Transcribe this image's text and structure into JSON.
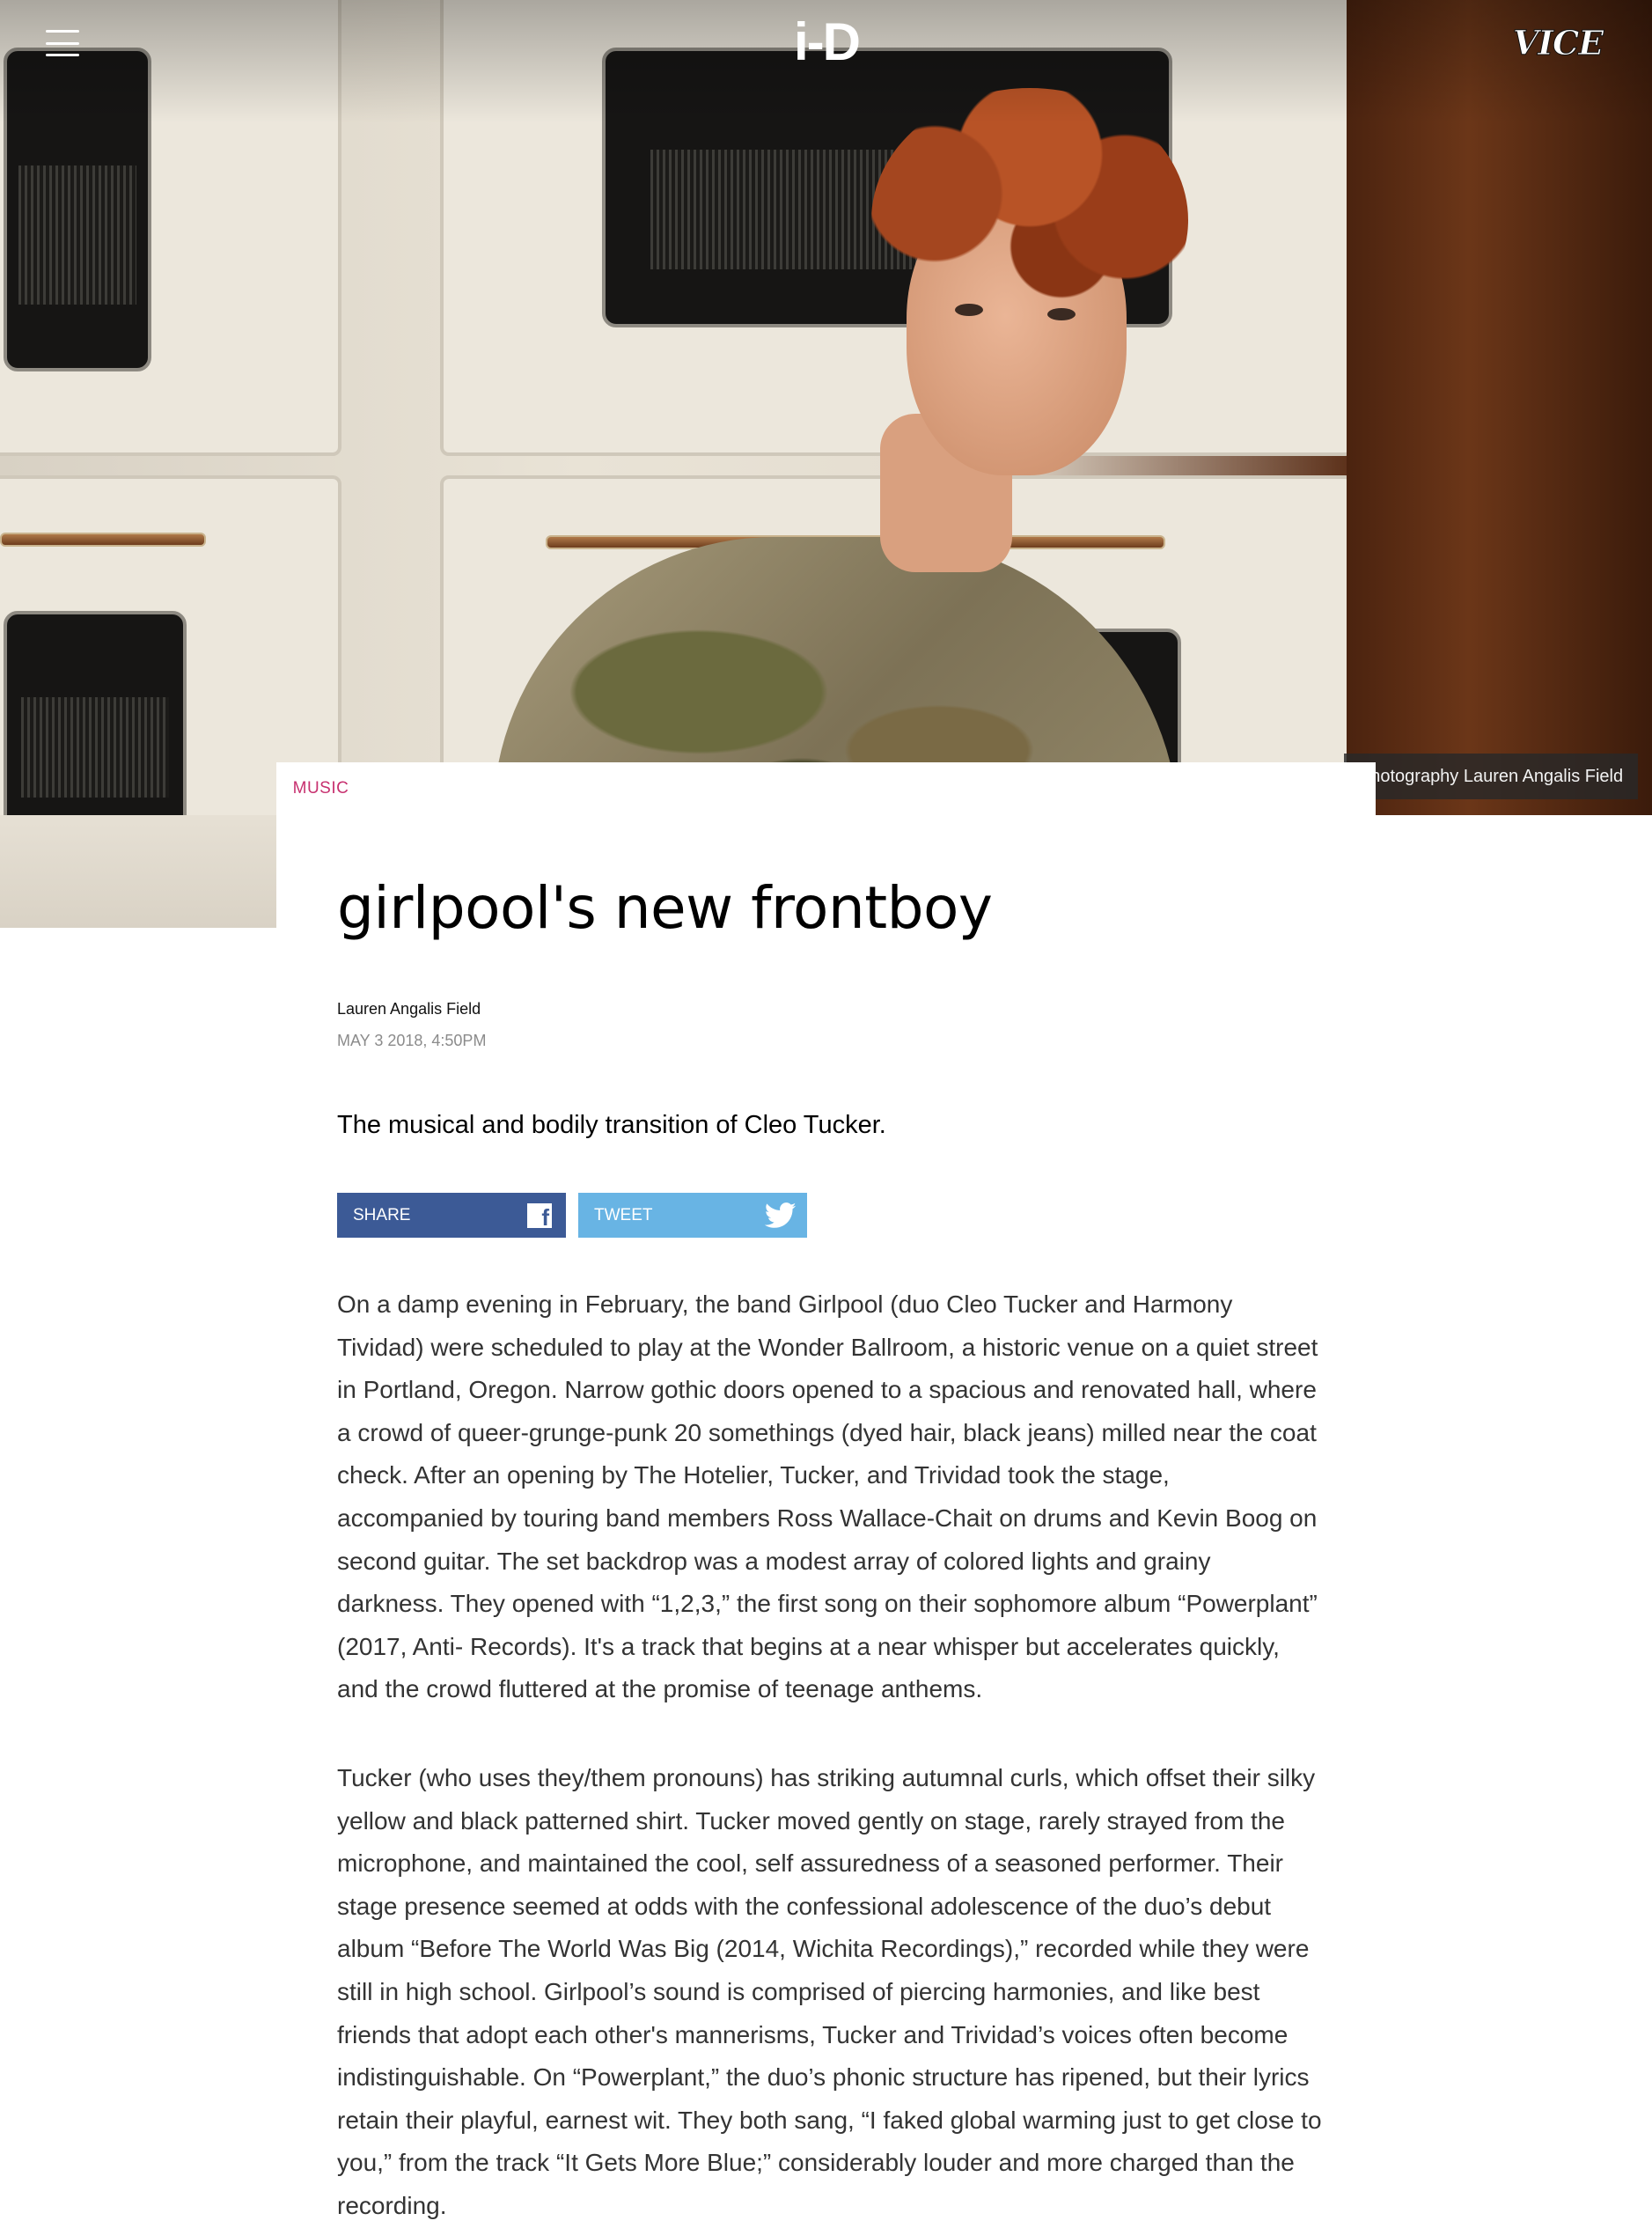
{
  "header": {
    "logo_text": "i-D",
    "brand_text": "VICE"
  },
  "hero": {
    "photo_credit": "Photography Lauren Angalis Field"
  },
  "article": {
    "section": "MUSIC",
    "title": "girlpool's new frontboy",
    "author": "Lauren Angalis Field",
    "date": "MAY 3 2018, 4:50PM",
    "dek": "The musical and bodily transition of Cleo Tucker.",
    "share": {
      "facebook_label": "SHARE",
      "twitter_label": "TWEET"
    },
    "paragraphs": [
      "On a damp evening in February, the band Girlpool (duo Cleo Tucker and Harmony Tividad) were scheduled to play at the Wonder Ballroom, a historic venue on a quiet street in Portland, Oregon. Narrow gothic doors opened to a spacious and renovated hall, where a crowd of queer-grunge-punk 20 somethings (dyed hair, black jeans) milled near the coat check. After an opening by The Hotelier, Tucker, and Trividad took the stage, accompanied by touring band members Ross Wallace-Chait on drums and Kevin Boog on second guitar. The set backdrop was a modest array of colored lights and grainy darkness. They opened with “1,2,3,” the first song on their sophomore album “Powerplant” (2017, Anti- Records). It's a track that begins at a near whisper but accelerates quickly, and the crowd fluttered at the promise of teenage anthems.",
      "Tucker (who uses they/them pronouns) has striking autumnal curls, which offset their silky yellow and black patterned shirt. Tucker moved gently on stage, rarely strayed from the microphone, and maintained the cool, self assuredness of a seasoned performer. Their stage presence seemed at odds with the confessional adolescence of the duo’s debut album “Before The World Was Big (2014, Wichita Recordings),” recorded while they were still in high school. Girlpool’s sound is comprised of piercing harmonies, and like best friends that adopt each other's mannerisms, Tucker and Trividad’s voices often become indistinguishable. On “Powerplant,” the duo’s phonic structure has ripened, but their lyrics retain their playful, earnest wit. They both sang, “I faked global warming just to get close to you,” from the track “It Gets More Blue;” considerably louder and more charged than the recording."
    ]
  },
  "icons": {
    "menu": "hamburger-menu-icon",
    "facebook": "facebook-icon",
    "twitter": "twitter-bird-icon"
  },
  "colors": {
    "section_tag": "#c7306f",
    "facebook": "#3c5a96",
    "twitter": "#68b4e4",
    "date_gray": "#8b8b8b"
  }
}
